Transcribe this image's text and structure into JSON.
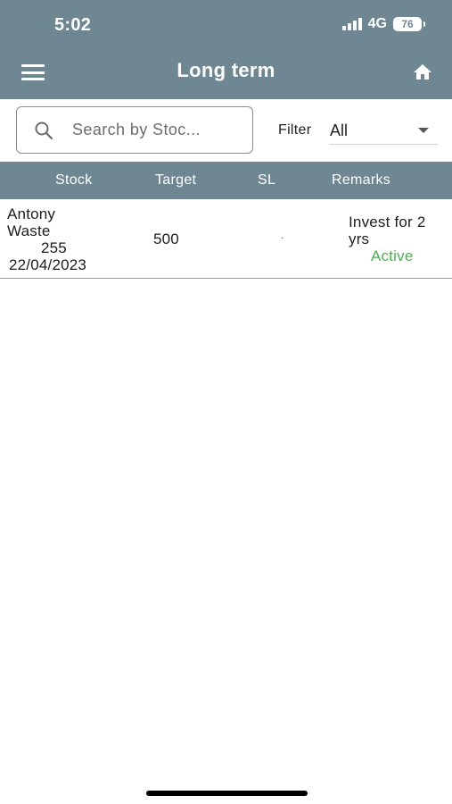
{
  "status_bar": {
    "time": "5:02",
    "network": "4G",
    "battery": "76"
  },
  "app_bar": {
    "title": "Long term",
    "menu_icon": "hamburger-menu-icon",
    "home_icon": "home-icon",
    "background_color": "#6f8793"
  },
  "search": {
    "placeholder": "Search by Stoc...",
    "icon": "search-icon"
  },
  "filter": {
    "label": "Filter",
    "selected": "All"
  },
  "table": {
    "columns": [
      "Stock",
      "Target",
      "SL",
      "Remarks"
    ],
    "rows": [
      {
        "stock_name": "Antony Waste",
        "price": "255",
        "date": "22/04/2023",
        "target": "500",
        "sl": ".",
        "remarks": "Invest for 2 yrs",
        "status": "Active",
        "status_color": "#4caf50"
      }
    ]
  }
}
